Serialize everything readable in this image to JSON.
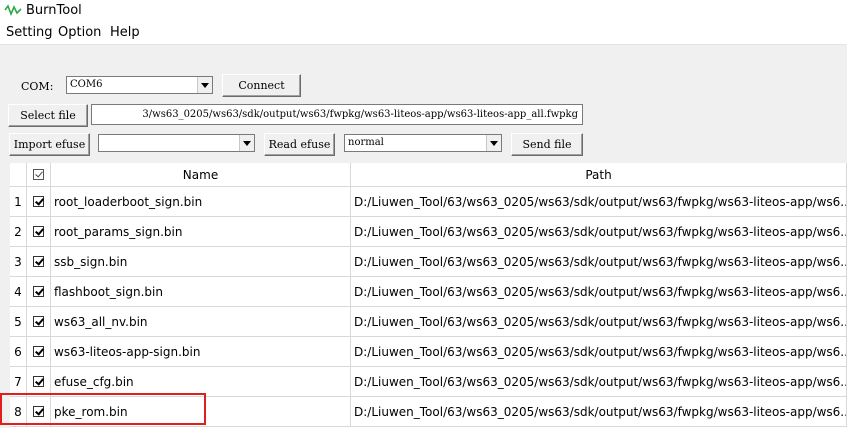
{
  "app": {
    "title": "BurnTool"
  },
  "menu": [
    "Setting",
    "Option",
    "Help"
  ],
  "com": {
    "label": "COM:",
    "selected": "COM6",
    "connect_label": "Connect"
  },
  "file": {
    "select_label": "Select file",
    "path": "3/ws63_0205/ws63/sdk/output/ws63/fwpkg/ws63-liteos-app/ws63-liteos-app_all.fwpkg"
  },
  "efuse": {
    "import_label": "Import efuse",
    "import_value": "",
    "read_label": "Read efuse",
    "mode": "normal",
    "send_label": "Send file"
  },
  "table": {
    "headers": {
      "name": "Name",
      "path": "Path"
    },
    "rows": [
      {
        "num": "1",
        "checked": true,
        "name": "root_loaderboot_sign.bin",
        "path": "D:/Liuwen_Tool/63/ws63_0205/ws63/sdk/output/ws63/fwpkg/ws63-liteos-app/ws6..."
      },
      {
        "num": "2",
        "checked": true,
        "name": "root_params_sign.bin",
        "path": "D:/Liuwen_Tool/63/ws63_0205/ws63/sdk/output/ws63/fwpkg/ws63-liteos-app/ws6..."
      },
      {
        "num": "3",
        "checked": true,
        "name": "ssb_sign.bin",
        "path": "D:/Liuwen_Tool/63/ws63_0205/ws63/sdk/output/ws63/fwpkg/ws63-liteos-app/ws6..."
      },
      {
        "num": "4",
        "checked": true,
        "name": "flashboot_sign.bin",
        "path": "D:/Liuwen_Tool/63/ws63_0205/ws63/sdk/output/ws63/fwpkg/ws63-liteos-app/ws6..."
      },
      {
        "num": "5",
        "checked": true,
        "name": "ws63_all_nv.bin",
        "path": "D:/Liuwen_Tool/63/ws63_0205/ws63/sdk/output/ws63/fwpkg/ws63-liteos-app/ws6..."
      },
      {
        "num": "6",
        "checked": true,
        "name": "ws63-liteos-app-sign.bin",
        "path": "D:/Liuwen_Tool/63/ws63_0205/ws63/sdk/output/ws63/fwpkg/ws63-liteos-app/ws6..."
      },
      {
        "num": "7",
        "checked": true,
        "name": "efuse_cfg.bin",
        "path": "D:/Liuwen_Tool/63/ws63_0205/ws63/sdk/output/ws63/fwpkg/ws63-liteos-app/ws6..."
      },
      {
        "num": "8",
        "checked": true,
        "name": "pke_rom.bin",
        "path": "D:/Liuwen_Tool/63/ws63_0205/ws63/sdk/output/ws63/fwpkg/ws63-liteos-app/ws6..."
      }
    ]
  },
  "colors": {
    "highlight": "#e01e1e",
    "icon": "#2ba84a"
  }
}
